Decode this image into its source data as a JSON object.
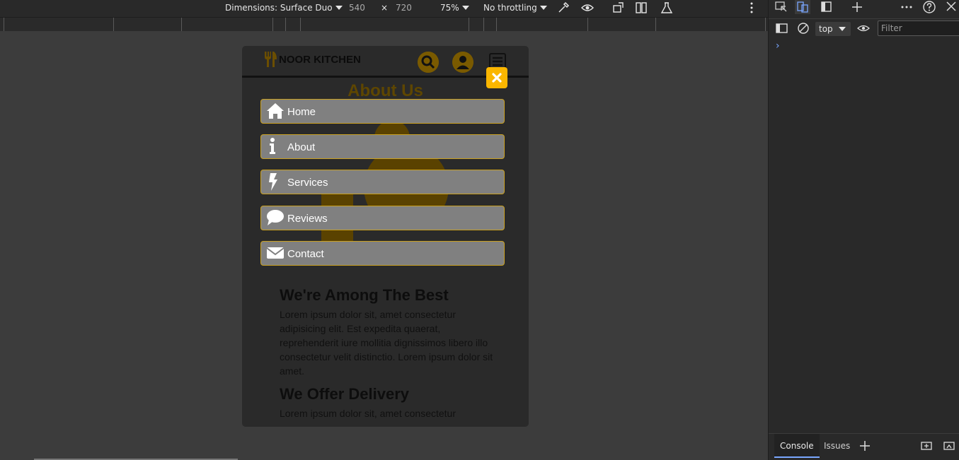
{
  "device_toolbar": {
    "dimensions_label": "Dimensions: Surface Duo",
    "width": "540",
    "times": "×",
    "height": "720",
    "zoom": "75%",
    "throttling": "No throttling"
  },
  "site": {
    "logo_text": "NOOR KITCHEN",
    "ghost_title": "About Us",
    "close_symbol": "✖"
  },
  "menu": {
    "items": [
      {
        "label": "Home",
        "icon": "home-icon"
      },
      {
        "label": "About",
        "icon": "info-icon"
      },
      {
        "label": "Services",
        "icon": "bolt-icon"
      },
      {
        "label": "Reviews",
        "icon": "comment-icon"
      },
      {
        "label": "Contact",
        "icon": "envelope-icon"
      }
    ]
  },
  "content": {
    "heading1": "We're Among The Best",
    "para1": "Lorem ipsum dolor sit, amet consectetur adipisicing elit. Est expedita quaerat, reprehenderit iure mollitia dignissimos libero illo consectetur velit distinctio. Lorem ipsum dolor sit amet.",
    "heading2": "We Offer Delivery",
    "para2": "Lorem ipsum dolor sit, amet consectetur"
  },
  "devtools": {
    "context": "top",
    "filter_placeholder": "Filter",
    "tabs": [
      "Console",
      "Issues"
    ],
    "prompt_symbol": "›"
  },
  "colors": {
    "accent": "#fbb600",
    "menu_bg": "#808080",
    "menu_border": "#c9a020"
  }
}
